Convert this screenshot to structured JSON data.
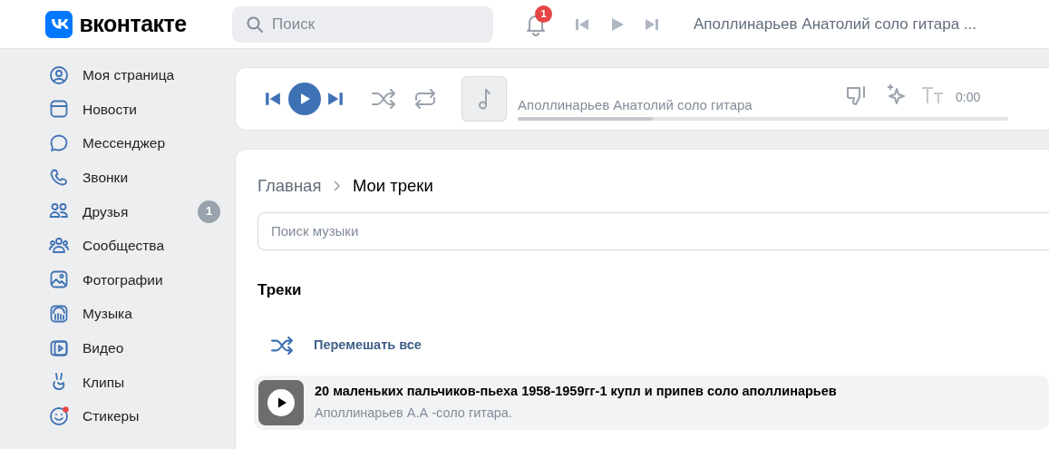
{
  "header": {
    "logo_text": "вконтакте",
    "search": {
      "placeholder": "Поиск"
    },
    "notifications": {
      "count": "1"
    },
    "now_playing": "Аполлинарьев Анатолий соло гитара ..."
  },
  "sidebar": {
    "items": [
      {
        "label": "Моя страница",
        "kind": "user"
      },
      {
        "label": "Новости",
        "kind": "news"
      },
      {
        "label": "Мессенджер",
        "kind": "chat"
      },
      {
        "label": "Звонки",
        "kind": "phone"
      },
      {
        "label": "Друзья",
        "kind": "friends",
        "badge": "1"
      },
      {
        "label": "Сообщества",
        "kind": "groups"
      },
      {
        "label": "Фотографии",
        "kind": "photo"
      },
      {
        "label": "Музыка",
        "kind": "music"
      },
      {
        "label": "Видео",
        "kind": "video"
      },
      {
        "label": "Клипы",
        "kind": "clips"
      },
      {
        "label": "Стикеры",
        "kind": "stickers",
        "dot": true
      }
    ]
  },
  "player": {
    "playing": false,
    "track": "Аполлинарьев Анатолий соло гитара",
    "time": "0:00",
    "progress": {
      "level": 0.275
    }
  },
  "breadcrumbs": [
    {
      "label": "Главная",
      "current": false
    },
    {
      "label": "Мои треки",
      "current": true
    }
  ],
  "music_search": {
    "placeholder": "Поиск музыки"
  },
  "section_title": "Треки",
  "shuffle_all": "Перемешать все",
  "tracks": [
    {
      "title": "20 маленьких пальчиков-пьеха 1958-1959гг-1 купл и припев соло аполлинарьев",
      "artist": "Аполлинарьев А.А -соло гитара.",
      "selected": true
    }
  ]
}
